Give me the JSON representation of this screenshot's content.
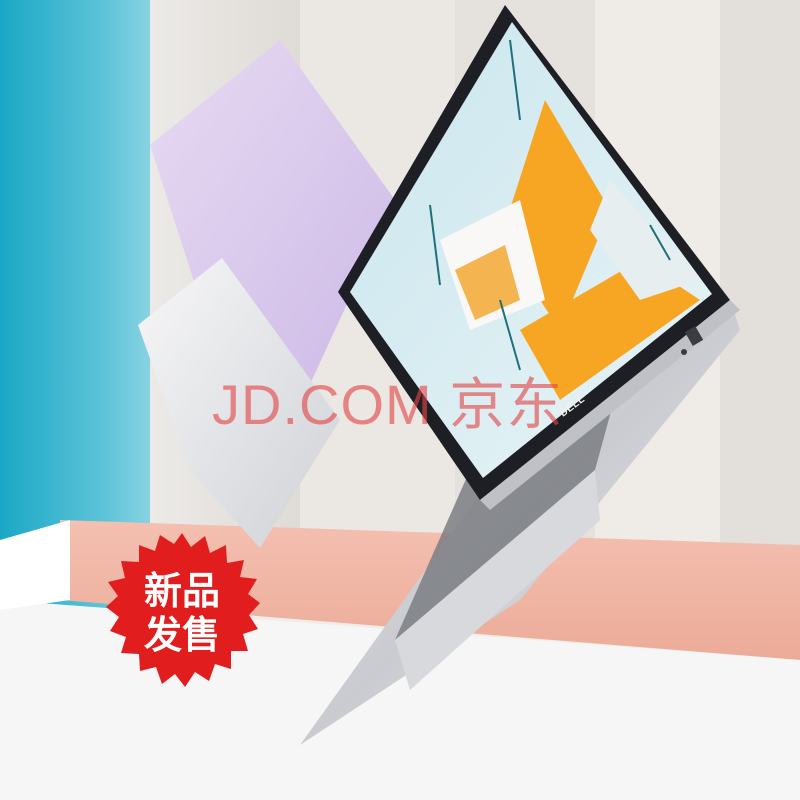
{
  "watermark": {
    "text": "JD.COM 京东"
  },
  "badge": {
    "line1": "新品",
    "line2": "发售",
    "color": "#e11d1d"
  },
  "laptop": {
    "brand_logo": "DELL",
    "lid_color": "#d8d8dc",
    "accent_color": "#f6a623"
  },
  "background": {
    "left_color": "#1aa8c6",
    "floor_color": "#f1b3a3"
  }
}
